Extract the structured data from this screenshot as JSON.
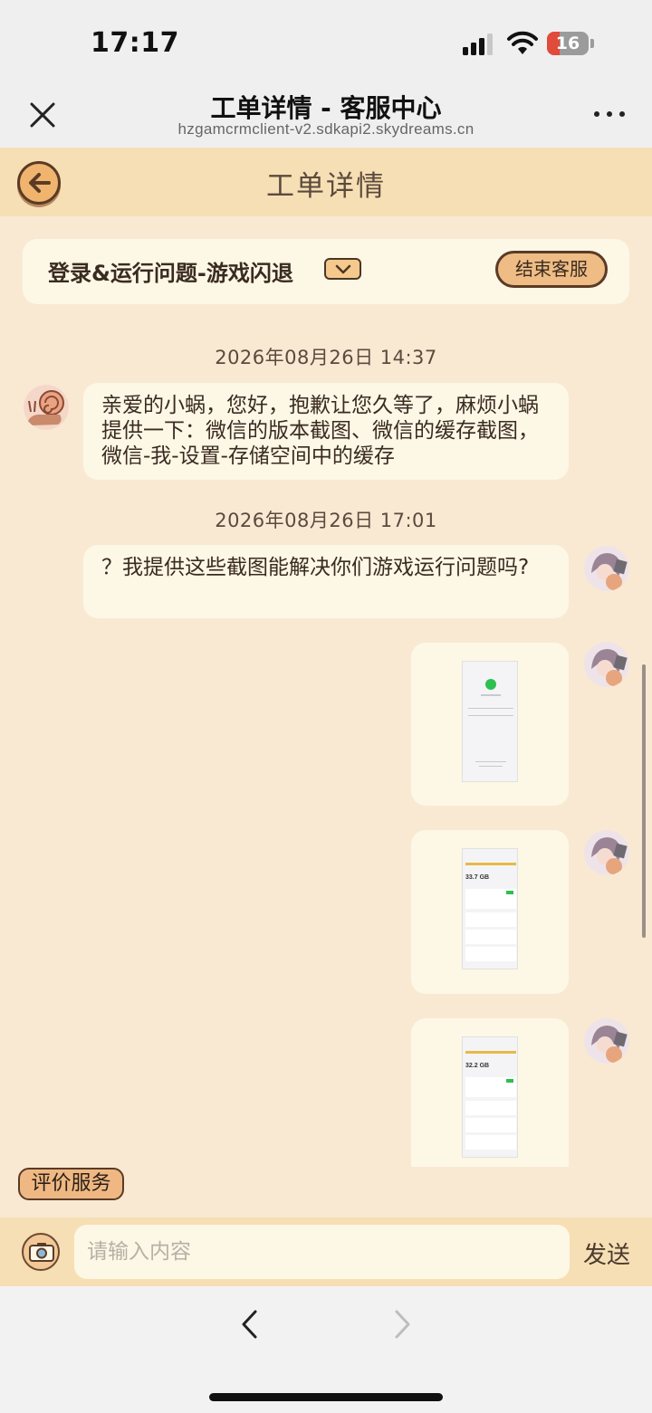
{
  "status_bar": {
    "time": "17:17",
    "battery": "16"
  },
  "browser": {
    "title": "工单详情 - 客服中心",
    "url": "hzgamcrmclient-v2.sdkapi2.skydreams.cn"
  },
  "app": {
    "title": "工单详情",
    "ticket_title": "登录&运行问题-游戏闪退",
    "end_service_label": "结束客服",
    "rate_service_label": "评价服务"
  },
  "chat": {
    "timestamps": [
      "2026年08月26日 14:37",
      "2026年08月26日 17:01"
    ],
    "messages": [
      {
        "sender": "agent",
        "text": "亲爱的小蜗，您好，抱歉让您久等了，麻烦小蜗提供一下：微信的版本截图、微信的缓存截图，微信-我-设置-存储空间中的缓存"
      },
      {
        "sender": "user",
        "text": "？我提供这些截图能解决你们游戏运行问题吗?"
      }
    ],
    "images": [
      {
        "sender": "user",
        "thumb": "wechat-version-screenshot"
      },
      {
        "sender": "user",
        "thumb": "storage-screenshot",
        "size_text": "33.7 GB"
      },
      {
        "sender": "user",
        "thumb": "storage-screenshot",
        "size_text": "32.2 GB"
      }
    ]
  },
  "composer": {
    "placeholder": "请输入内容",
    "send_label": "发送"
  },
  "colors": {
    "page_bg": "#f9e9d3",
    "header_bg": "#f6dfb4",
    "bubble_bg": "#fdf7e6",
    "accent": "#eebc84",
    "outline": "#5a3b26"
  }
}
